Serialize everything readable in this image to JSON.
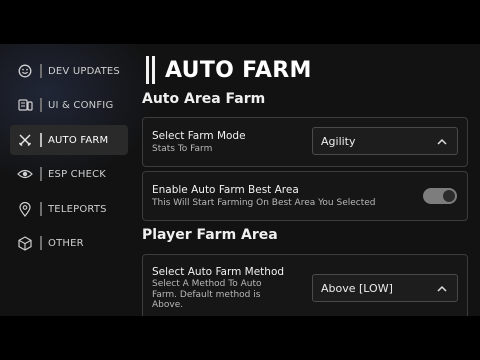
{
  "sidebar": {
    "items": [
      {
        "label": "DEV UPDATES",
        "icon": "smiley-icon",
        "active": false
      },
      {
        "label": "UI & CONFIG",
        "icon": "config-icon",
        "active": false
      },
      {
        "label": "AUTO FARM",
        "icon": "crossed-swords-icon",
        "active": true
      },
      {
        "label": "ESP CHECK",
        "icon": "eye-icon",
        "active": false
      },
      {
        "label": "TELEPORTS",
        "icon": "map-pin-icon",
        "active": false
      },
      {
        "label": "OTHER",
        "icon": "cube-icon",
        "active": false
      }
    ]
  },
  "page": {
    "title": "AUTO FARM"
  },
  "sections": {
    "auto_area": {
      "title": "Auto Area Farm",
      "farm_mode": {
        "title": "Select Farm Mode",
        "desc": "Stats To Farm",
        "value": "Agility"
      },
      "best_area": {
        "title": "Enable Auto Farm Best Area",
        "desc": "This Will Start Farming On Best Area You Selected",
        "enabled": true
      }
    },
    "player_area": {
      "title": "Player Farm Area",
      "method": {
        "title": "Select Auto Farm Method",
        "desc_lines": [
          "Select A Method To Auto",
          "Farm. Default method is",
          "Above."
        ],
        "value": "Above [LOW]"
      }
    }
  },
  "colors": {
    "background": "#121212",
    "card": "#161616",
    "border": "#3c3c3c",
    "toggle_on": "#7d7d7d"
  }
}
